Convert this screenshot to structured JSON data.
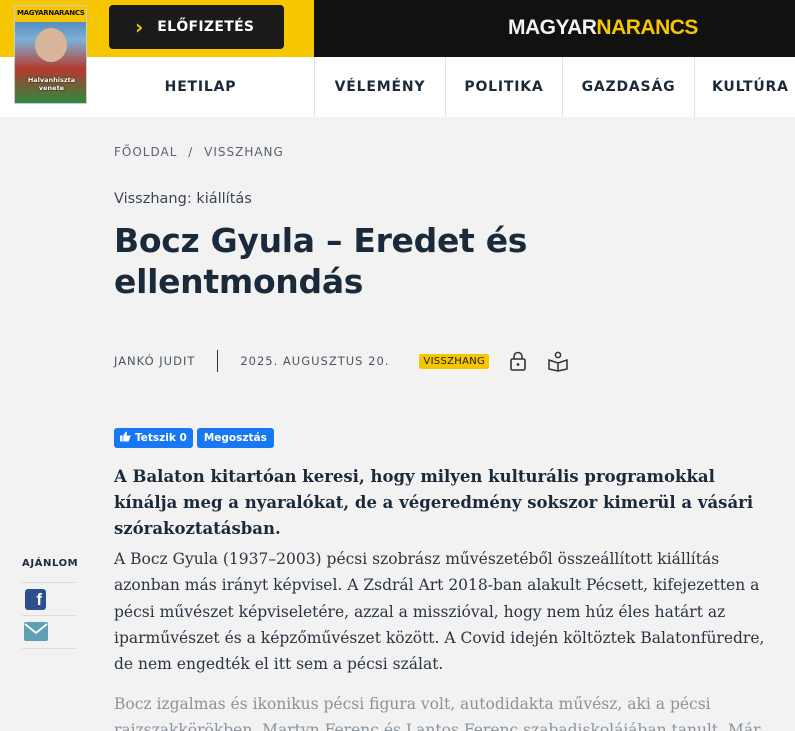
{
  "header": {
    "cover_brand": "MAGYARNARANCS",
    "cover_headline": "Halvanhiszta venete",
    "subscribe_label": "ELŐFIZETÉS",
    "logo_left": "MAGYAR",
    "logo_right": "NARANCS",
    "nav": [
      "HETILAP",
      "VÉLEMÉNY",
      "POLITIKA",
      "GAZDASÁG",
      "KULTÚRA"
    ]
  },
  "breadcrumb": {
    "home": "FŐOLDAL",
    "sep": "/",
    "section": "VISSZHANG"
  },
  "article": {
    "kicker": "Visszhang: kiállítás",
    "title": "Bocz Gyula – Eredet és ellentmondás",
    "author": "JANKÓ JUDIT",
    "date": "2025. AUGUSZTUS 20.",
    "badge": "VISSZHANG",
    "fb_like": "Tetszik 0",
    "fb_share": "Megosztás",
    "lead": "A Balaton kitartóan keresi, hogy milyen kulturális programokkal kínálja meg a nyaralókat, de a végeredmény sokszor kimerül a vásári szórakoztatásban.",
    "paragraph1": "A Bocz Gyula (1937–2003) pécsi szobrász művészetéből összeállított kiállítás azonban más irányt képvisel. A Zsdrál Art 2018-ban alakult Pécsett, kifejezetten a pécsi művészet képviseletére, azzal a misszióval, hogy nem húz éles határt az iparművészet és a képzőművészet között. A Covid idején költöztek Balatonfüredre, de nem engedték el itt sem a pécsi szálat.",
    "paragraph2": "Bocz izgalmas és ikonikus pécsi figura volt, autodidakta művész, aki a pécsi rajzszakkörökben, Martyn Ferenc és Lantos Ferenc szabadiskolájában tanult. Már"
  },
  "share": {
    "label": "AJÁNLOM"
  },
  "colors": {
    "accent": "#f6c700",
    "dark": "#111111",
    "facebook": "#1877f2"
  },
  "icons": [
    "chevron-right-icon",
    "lock-icon",
    "reader-icon",
    "facebook-icon",
    "mail-icon",
    "thumbs-up-icon"
  ]
}
